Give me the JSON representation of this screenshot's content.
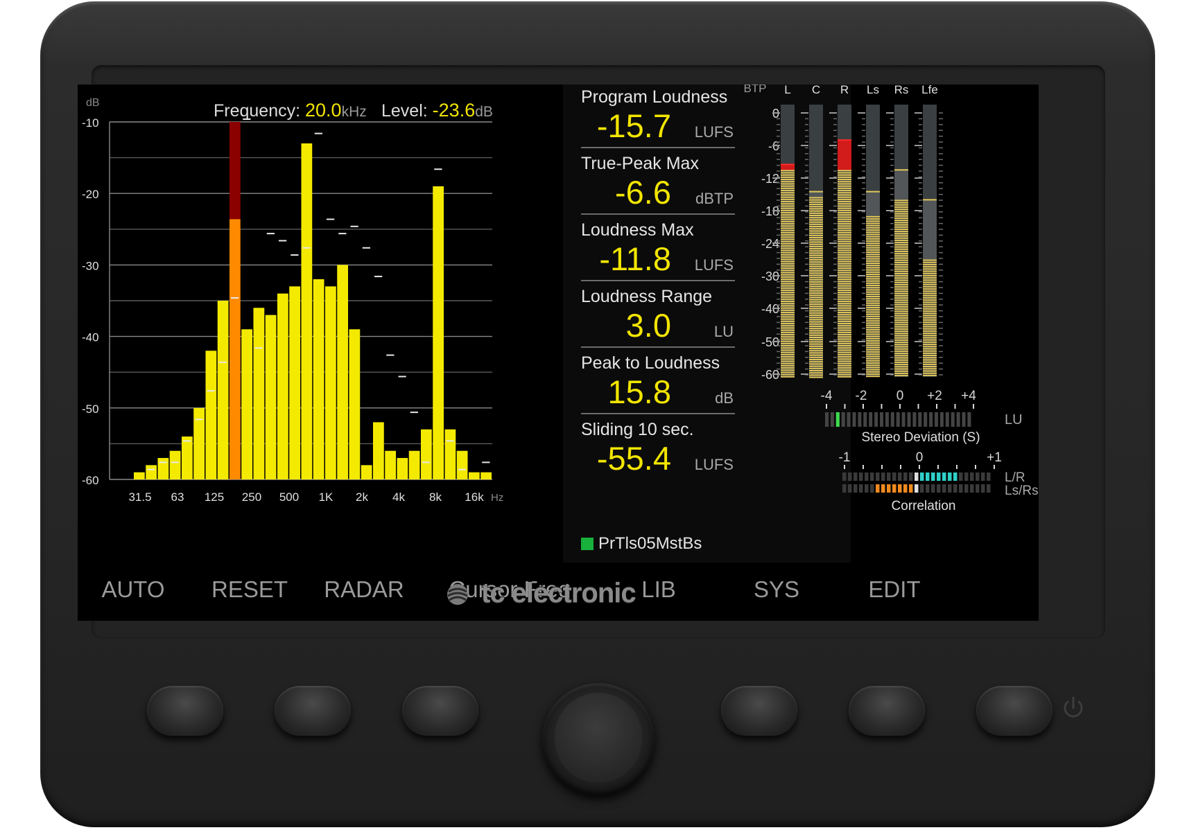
{
  "brand": "tc electronic",
  "header": {
    "frequency_label": "Frequency:",
    "frequency_value": "20.0",
    "frequency_unit": "kHz",
    "level_label": "Level:",
    "level_value": "-23.6",
    "level_unit": "dB"
  },
  "chart_data": {
    "type": "bar",
    "ylabel": "dB",
    "xunit": "Hz",
    "ylim": [
      -60,
      -10
    ],
    "yticks": [
      "-10",
      "-20",
      "-30",
      "-40",
      "-50",
      "-60"
    ],
    "xticks": [
      "31.5",
      "63",
      "125",
      "250",
      "500",
      "1K",
      "2k",
      "4k",
      "8k",
      "16k"
    ],
    "values": [
      -60,
      -60,
      -59,
      -58,
      -57,
      -56,
      -54,
      -50,
      -42,
      -35,
      -10,
      -39,
      -36,
      -37,
      -34,
      -33,
      -13,
      -32,
      -33,
      -30,
      -39,
      -58,
      -52,
      -56,
      -57,
      -56,
      -53,
      -19,
      -53,
      -56,
      -59,
      -59
    ],
    "peaks": [
      -60,
      -60,
      -60,
      -59,
      -58,
      -58,
      -55,
      -52,
      -48,
      -44,
      -35,
      -10,
      -42,
      -26,
      -27,
      -29,
      -28,
      -12,
      -24,
      -26,
      -25,
      -28,
      -32,
      -43,
      -46,
      -51,
      -58,
      -17,
      -55,
      -59,
      -60,
      -58
    ],
    "highlight_index": 10,
    "highlight_level": -23.6
  },
  "metrics": [
    {
      "label": "Program Loudness",
      "value": "-15.7",
      "unit": "LUFS"
    },
    {
      "label": "True-Peak Max",
      "value": "-6.6",
      "unit": "dBTP"
    },
    {
      "label": "Loudness Max",
      "value": "-11.8",
      "unit": "LUFS"
    },
    {
      "label": "Loudness Range",
      "value": "3.0",
      "unit": "LU"
    },
    {
      "label": "Peak to Loudness",
      "value": "15.8",
      "unit": "dB"
    },
    {
      "label": "Sliding 10 sec.",
      "value": "-55.4",
      "unit": "LUFS"
    }
  ],
  "preset": "PrTls05MstBs",
  "meters": {
    "unit": "dBTP",
    "scale": [
      "0",
      "-6",
      "-12",
      "-18",
      "-24",
      "-30",
      "-40",
      "-50",
      "-60"
    ],
    "channels": [
      {
        "name": "L",
        "level": -10.5,
        "peak": -9.5,
        "red": true
      },
      {
        "name": "C",
        "level": -15.5,
        "peak": -14.5,
        "red": false
      },
      {
        "name": "R",
        "level": -10.5,
        "peak": -5,
        "red": true
      },
      {
        "name": "Ls",
        "level": -19,
        "peak": -14.5,
        "red": false
      },
      {
        "name": "Rs",
        "level": -16,
        "peak": -10.5,
        "red": false
      },
      {
        "name": "Lfe",
        "level": -27,
        "peak": -16,
        "red": false
      }
    ]
  },
  "stereo_deviation": {
    "scale": [
      "-4",
      "-2",
      "0",
      "+2",
      "+4"
    ],
    "unit": "LU",
    "label": "Stereo Deviation (S)",
    "value": -3.5
  },
  "correlation": {
    "scale": [
      "-1",
      "0",
      "+1"
    ],
    "row_labels": [
      "L/R",
      "Ls/Rs"
    ],
    "label": "Correlation",
    "lr_value": 0.55,
    "lsrs_value": -0.55
  },
  "softkeys": [
    "AUTO",
    "RESET",
    "RADAR",
    "Cursor Freq.",
    "LIB",
    "SYS",
    "EDIT"
  ],
  "colors": {
    "bar": "#f4ea00",
    "highlight": "#ff8a00",
    "highlight_dark": "#8b0000",
    "meter": "#e3c85a",
    "deviation": "#3ddb4f",
    "corr_lr": "#2fd0c8",
    "corr_lsrs": "#f28a1e"
  }
}
